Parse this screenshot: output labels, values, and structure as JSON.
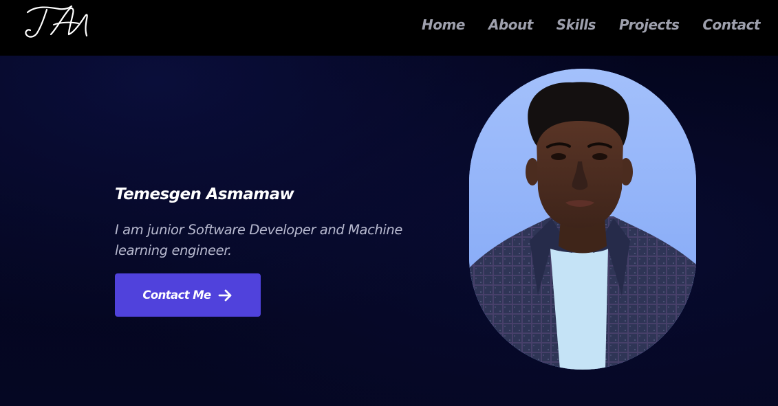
{
  "header": {
    "logo_text": "TA",
    "nav": [
      {
        "label": "Home"
      },
      {
        "label": "About"
      },
      {
        "label": "Skills"
      },
      {
        "label": "Projects"
      },
      {
        "label": "Contact"
      }
    ]
  },
  "hero": {
    "name": "Temesgen Asmamaw",
    "tagline": "I am junior Software Developer and Machine learning engineer.",
    "cta_label": "Contact Me",
    "cta_icon": "arrow-right-icon"
  },
  "colors": {
    "background": "#04051c",
    "navbar": "#000000",
    "nav_text": "#9ea0ad",
    "accent": "#5042dc",
    "portrait_background": "#8fb3fb"
  }
}
